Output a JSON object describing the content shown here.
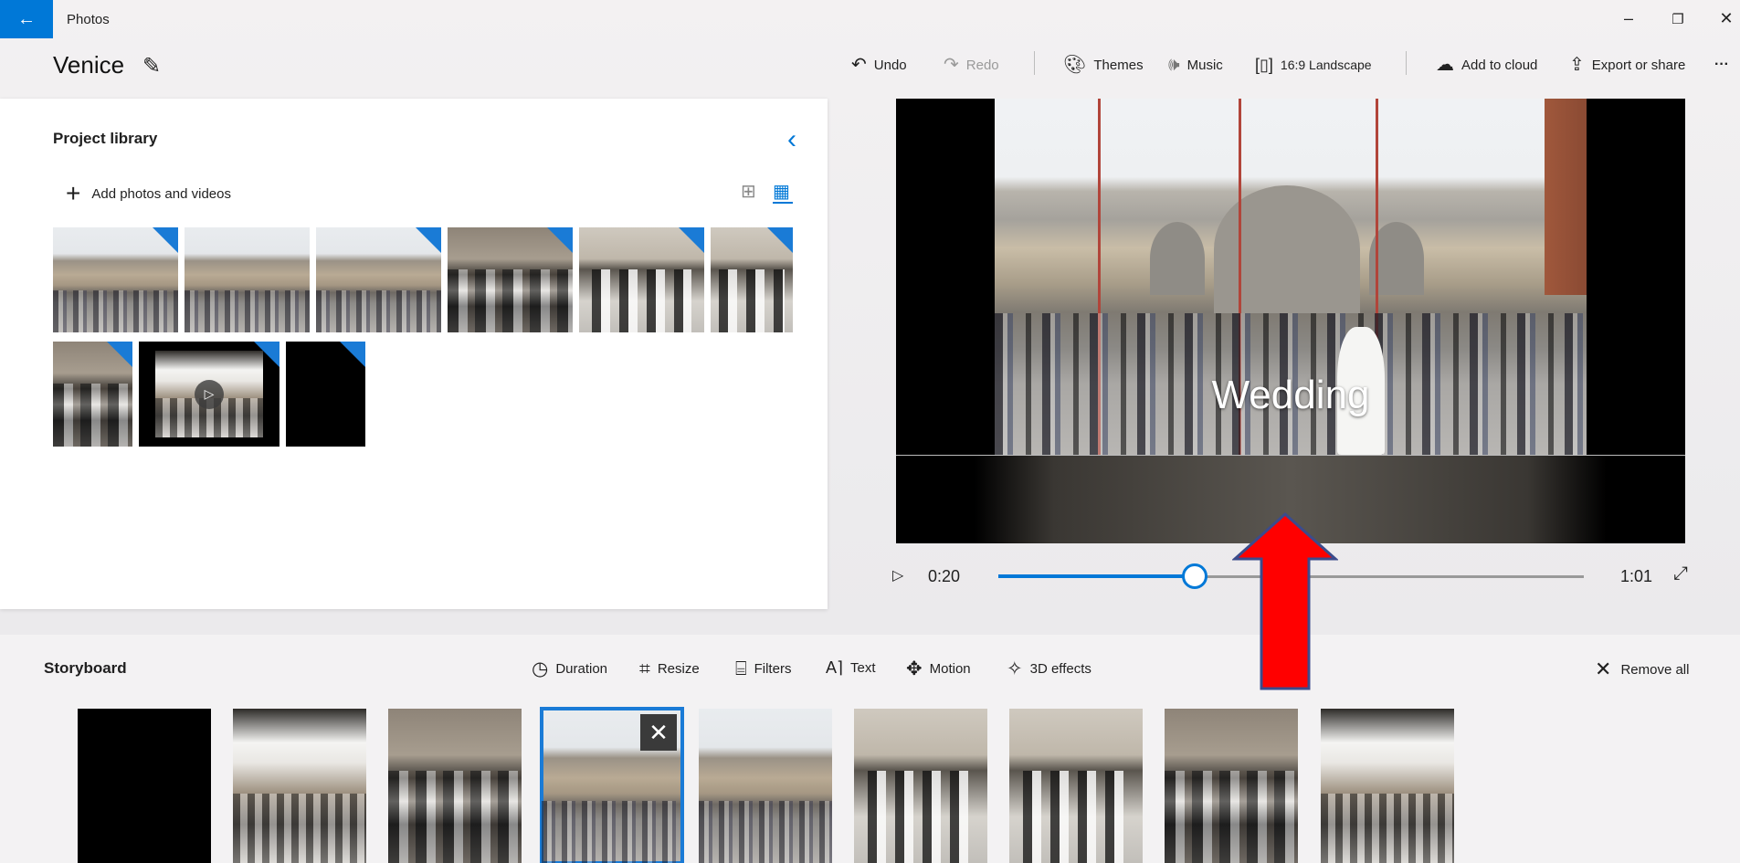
{
  "window": {
    "app_title": "Photos",
    "minimize_glyph": "–",
    "restore_glyph": "❐",
    "close_glyph": "✕",
    "back_glyph": "←"
  },
  "project": {
    "title": "Venice"
  },
  "toolbar": {
    "undo": "Undo",
    "redo": "Redo",
    "themes": "Themes",
    "music": "Music",
    "aspect": "16:9 Landscape",
    "add_to_cloud": "Add to cloud",
    "export": "Export or share",
    "more": "···"
  },
  "library": {
    "title": "Project library",
    "add_label": "Add photos and videos",
    "items": [
      {
        "icon": "photo",
        "scene": "basilica"
      },
      {
        "icon": "photo",
        "scene": "basilica"
      },
      {
        "icon": "photo",
        "scene": "basilica"
      },
      {
        "icon": "photo",
        "scene": "people"
      },
      {
        "icon": "photo",
        "scene": "arches"
      },
      {
        "icon": "photo",
        "scene": "arches"
      },
      {
        "icon": "photo",
        "scene": "people"
      },
      {
        "icon": "video",
        "scene": "cafe"
      },
      {
        "icon": "photo",
        "scene": "black"
      }
    ]
  },
  "preview": {
    "caption": "Wedding",
    "current_time": "0:20",
    "total_time": "1:01",
    "progress_fraction": 0.335
  },
  "storyboard": {
    "title": "Storyboard",
    "tools": [
      "Duration",
      "Resize",
      "Filters",
      "Text",
      "Motion",
      "3D effects"
    ],
    "remove_all": "Remove all",
    "cards": [
      {
        "scene": "black",
        "selected": false
      },
      {
        "scene": "cafe",
        "selected": false
      },
      {
        "scene": "people",
        "selected": false
      },
      {
        "scene": "basilica",
        "selected": true
      },
      {
        "scene": "basilica",
        "selected": false
      },
      {
        "scene": "arches",
        "selected": false
      },
      {
        "scene": "arches",
        "selected": false
      },
      {
        "scene": "people",
        "selected": false
      },
      {
        "scene": "cafe",
        "selected": false
      }
    ]
  },
  "colors": {
    "accent": "#0078d7",
    "annotation_arrow": "#ff0000"
  }
}
